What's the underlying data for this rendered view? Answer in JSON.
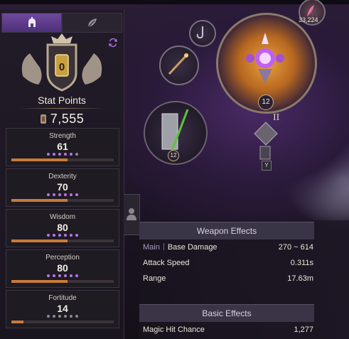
{
  "tabs": {
    "character": "helmet-icon",
    "skills": "leaf-icon"
  },
  "crest": {
    "level": "0",
    "label": "Stat Points",
    "value": "7,555"
  },
  "stats": [
    {
      "name": "Strength",
      "value": "61",
      "dots_on": 5,
      "dots_total": 6,
      "progress": 0.55
    },
    {
      "name": "Dexterity",
      "value": "70",
      "dots_on": 6,
      "dots_total": 6,
      "progress": 0.55
    },
    {
      "name": "Wisdom",
      "value": "80",
      "dots_on": 6,
      "dots_total": 6,
      "progress": 0.55
    },
    {
      "name": "Perception",
      "value": "80",
      "dots_on": 6,
      "dots_total": 6,
      "progress": 0.55
    },
    {
      "name": "Fortitude",
      "value": "14",
      "dots_on": 0,
      "dots_total": 6,
      "progress": 0.12
    }
  ],
  "equipment": {
    "currency_count": "33,224",
    "main_weapon_level": "12",
    "sub_weapon_level": "12",
    "slot_roman": "II",
    "slot_key": "Y"
  },
  "weapon_effects": {
    "title": "Weapon Effects",
    "rows": [
      {
        "tag": "Main",
        "label": "Base Damage",
        "value": "270 ~ 614"
      },
      {
        "label": "Attack Speed",
        "value": "0.311s"
      },
      {
        "label": "Range",
        "value": "17.63m"
      }
    ]
  },
  "basic_effects": {
    "title": "Basic Effects",
    "rows": [
      {
        "label": "Magic Hit Chance",
        "value": "1,277"
      }
    ]
  },
  "colors": {
    "accent": "#7a4fb0",
    "bar": "#c87a3a",
    "gold": "#c8a060"
  }
}
